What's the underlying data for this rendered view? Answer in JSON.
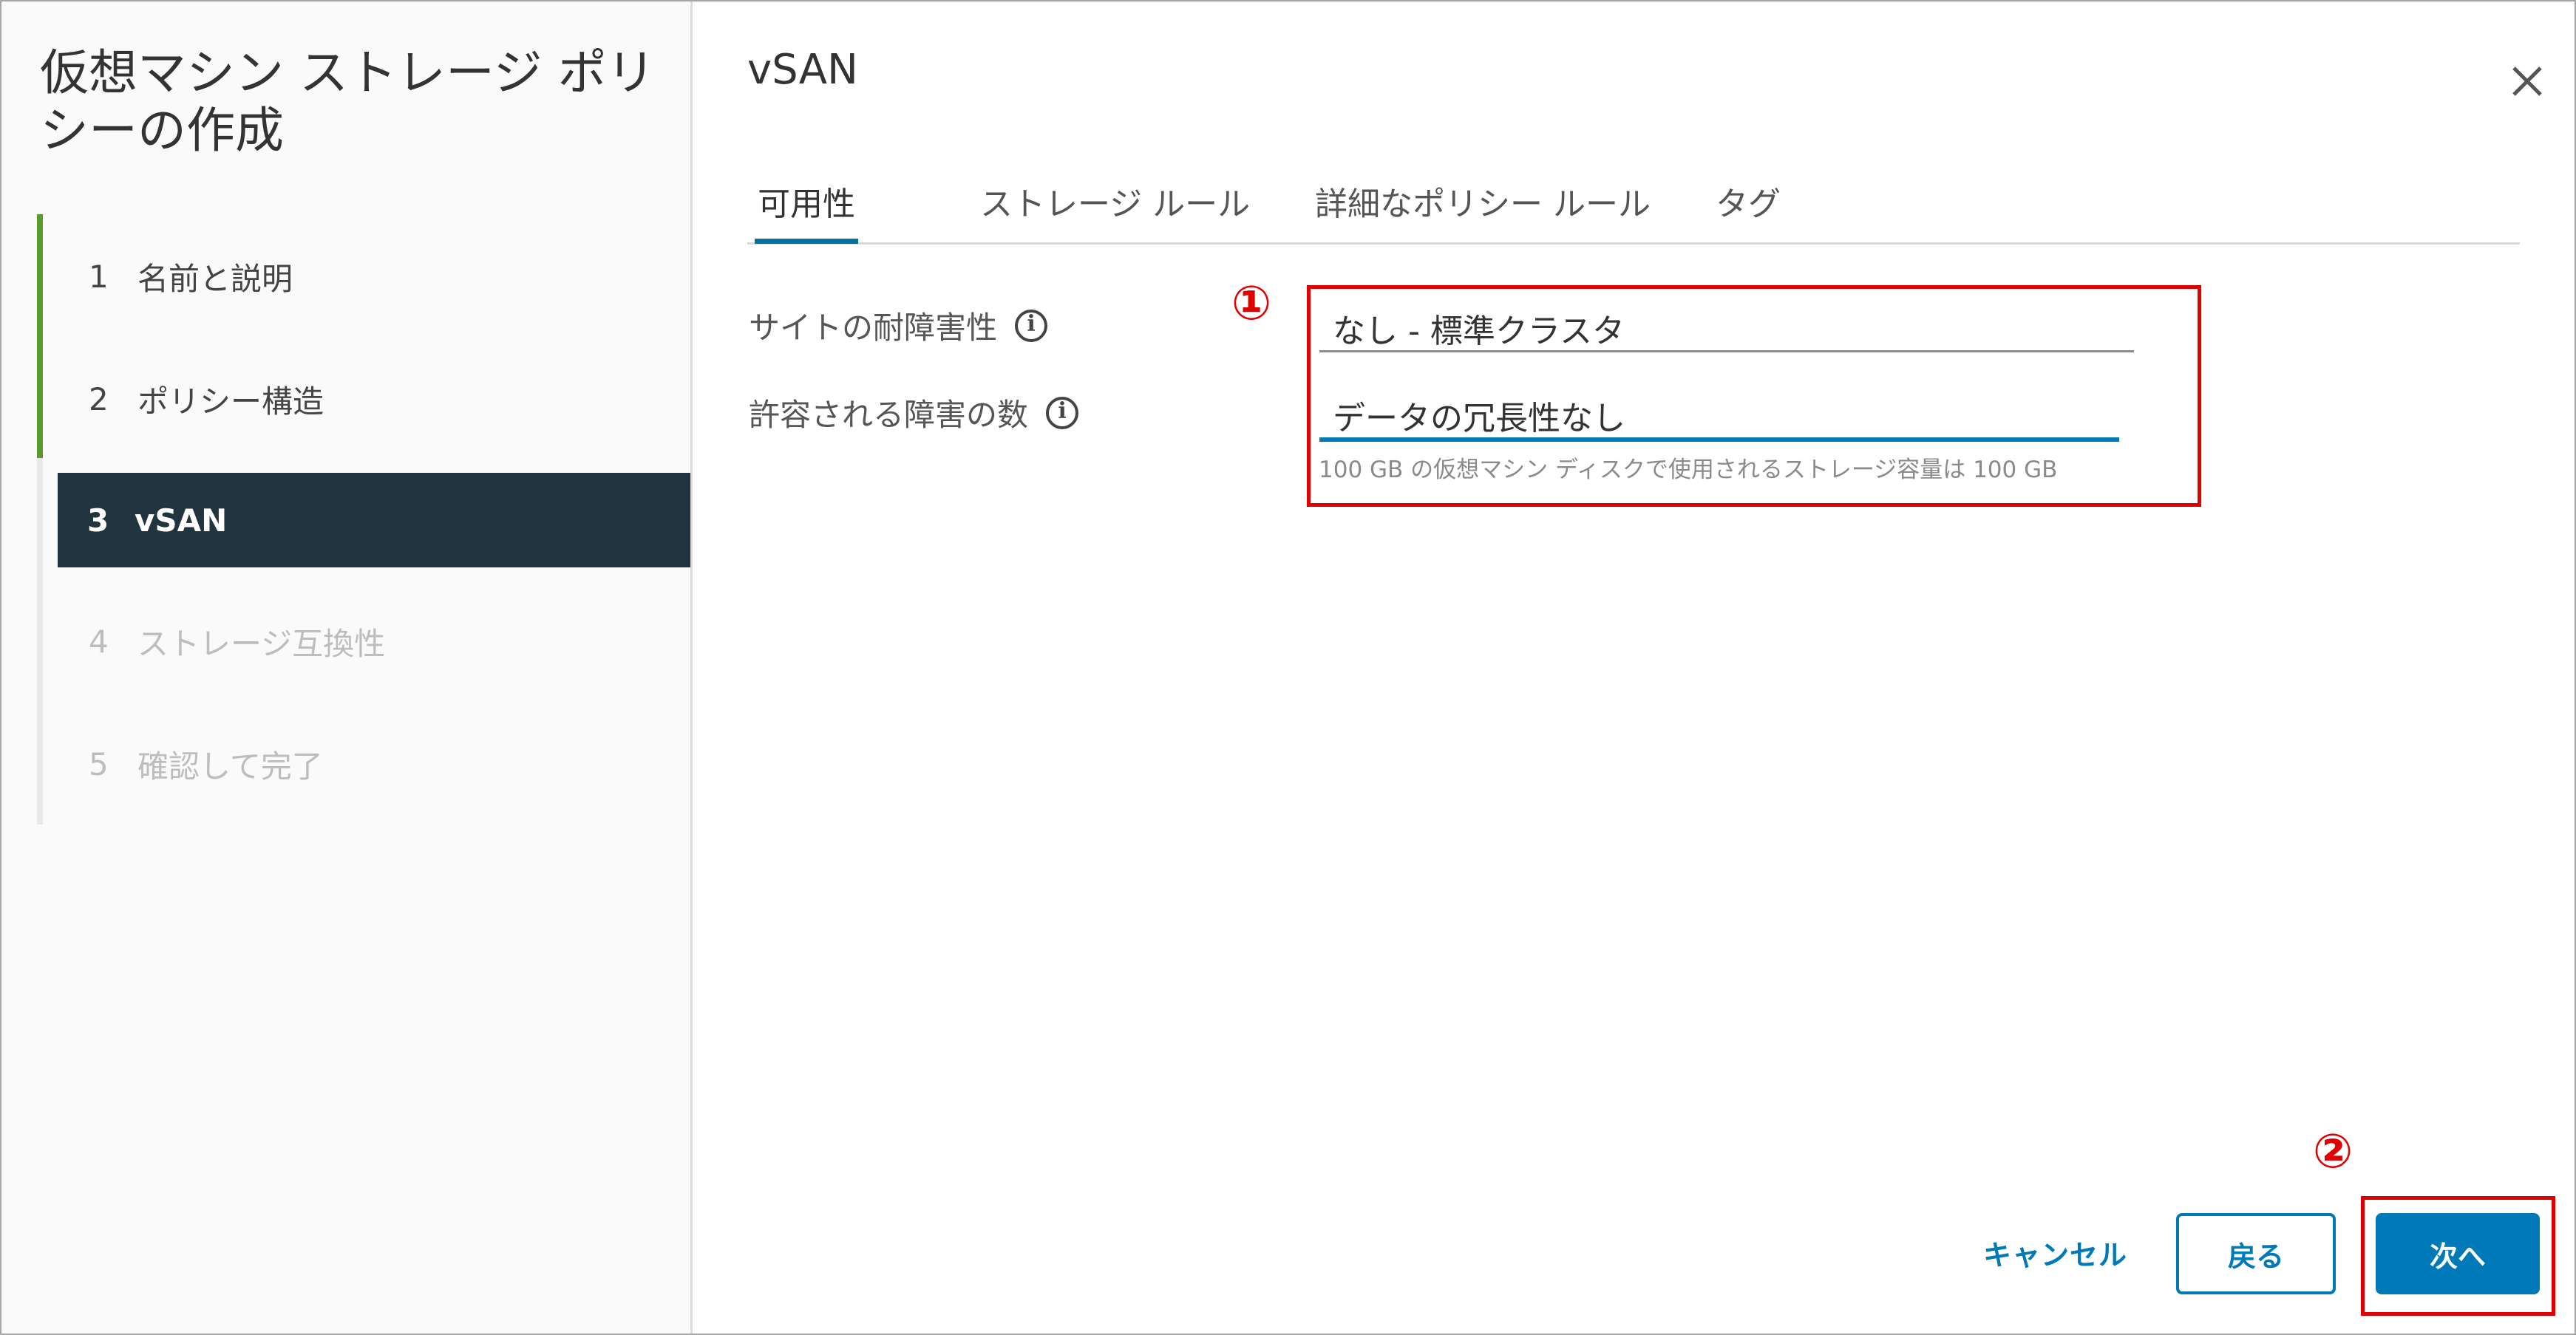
{
  "wizard": {
    "title": "仮想マシン ストレージ ポリシーの作成",
    "steps": [
      {
        "num": "1",
        "label": "名前と説明",
        "state": "done"
      },
      {
        "num": "2",
        "label": "ポリシー構造",
        "state": "done"
      },
      {
        "num": "3",
        "label": "vSAN",
        "state": "active"
      },
      {
        "num": "4",
        "label": "ストレージ互換性",
        "state": "disabled"
      },
      {
        "num": "5",
        "label": "確認して完了",
        "state": "disabled"
      }
    ]
  },
  "page": {
    "title": "vSAN",
    "close_icon": "close-icon"
  },
  "tabs": [
    {
      "label": "可用性",
      "active": true
    },
    {
      "label": "ストレージ ルール",
      "active": false
    },
    {
      "label": "詳細なポリシー ルール",
      "active": false
    },
    {
      "label": "タグ",
      "active": false
    }
  ],
  "form": {
    "site_ft_label": "サイトの耐障害性",
    "site_ft_value": "なし - 標準クラスタ",
    "failures_label": "許容される障害の数",
    "failures_value": "データの冗長性なし",
    "helper": "100 GB の仮想マシン ディスクで使用されるストレージ容量は 100 GB"
  },
  "annotations": {
    "mark1": "①",
    "mark2": "②"
  },
  "footer": {
    "cancel": "キャンセル",
    "back": "戻る",
    "next": "次へ"
  },
  "colors": {
    "accent": "#0079b8",
    "active_step_bg": "#22343e",
    "progress_green": "#5a9a2e",
    "highlight_red": "#e00000"
  }
}
